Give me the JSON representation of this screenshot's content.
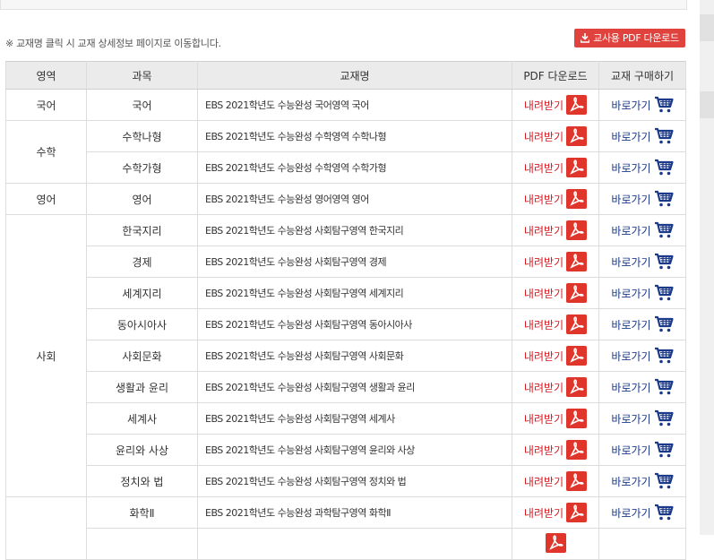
{
  "notice": "※ 교재명 클릭 시 교재 상세정보 페이지로 이동합니다.",
  "teacher_download": {
    "label": "교사용 PDF 다운로드"
  },
  "table": {
    "headers": [
      "영역",
      "과목",
      "교재명",
      "PDF 다운로드",
      "교재 구매하기"
    ],
    "download_label": "내려받기",
    "buy_label": "바로가기",
    "rows": [
      {
        "area": "국어",
        "subject": "국어",
        "title": "EBS 2021학년도 수능완성 국어영역 국어"
      },
      {
        "area": "수학",
        "subject": "수학나형",
        "title": "EBS 2021학년도 수능완성 수학영역 수학나형"
      },
      {
        "area": "",
        "subject": "수학가형",
        "title": "EBS 2021학년도 수능완성 수학영역 수학가형"
      },
      {
        "area": "영어",
        "subject": "영어",
        "title": "EBS 2021학년도 수능완성 영어영역 영어"
      },
      {
        "area": "사회",
        "subject": "한국지리",
        "title": "EBS 2021학년도 수능완성 사회탐구영역 한국지리"
      },
      {
        "area": "",
        "subject": "경제",
        "title": "EBS 2021학년도 수능완성 사회탐구영역 경제"
      },
      {
        "area": "",
        "subject": "세계지리",
        "title": "EBS 2021학년도 수능완성 사회탐구영역 세계지리"
      },
      {
        "area": "",
        "subject": "동아시아사",
        "title": "EBS 2021학년도 수능완성 사회탐구영역 동아시아사"
      },
      {
        "area": "",
        "subject": "사회문화",
        "title": "EBS 2021학년도 수능완성 사회탐구영역 사회문화"
      },
      {
        "area": "",
        "subject": "생활과 윤리",
        "title": "EBS 2021학년도 수능완성 사회탐구영역 생활과 윤리"
      },
      {
        "area": "",
        "subject": "세계사",
        "title": "EBS 2021학년도 수능완성 사회탐구영역 세계사"
      },
      {
        "area": "",
        "subject": "윤리와 사상",
        "title": "EBS 2021학년도 수능완성 사회탐구영역 윤리와 사상"
      },
      {
        "area": "",
        "subject": "정치와 법",
        "title": "EBS 2021학년도 수능완성 사회탐구영역 정치와 법"
      },
      {
        "area": "",
        "subject": "화학Ⅱ",
        "title": "EBS 2021학년도 수능완성 과학탐구영역 화학Ⅱ"
      }
    ]
  },
  "colors": {
    "download": "#d71920",
    "buy": "#1c3a8a",
    "pdf_icon": "#e0352b",
    "header_bg": "#ebebeb"
  },
  "icons": {
    "download": "pdf-icon",
    "buy": "cart-icon",
    "teacher": "download-icon"
  }
}
